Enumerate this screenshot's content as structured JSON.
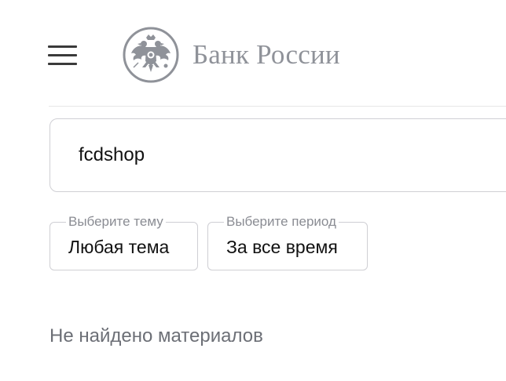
{
  "header": {
    "menu_icon": "hamburger-menu-icon",
    "logo_icon": "double-headed-eagle-emblem-icon",
    "logo_text": "Банк России"
  },
  "search": {
    "value": "fcdshop"
  },
  "filters": {
    "topic": {
      "legend": "Выберите тему",
      "value": "Любая тема"
    },
    "period": {
      "legend": "Выберите период",
      "value": "За все время"
    }
  },
  "results": {
    "empty_message": "Не найдено материалов"
  },
  "colors": {
    "logo": "#8f9299",
    "border": "#cfcfd4",
    "muted_text": "#6c6f76"
  }
}
